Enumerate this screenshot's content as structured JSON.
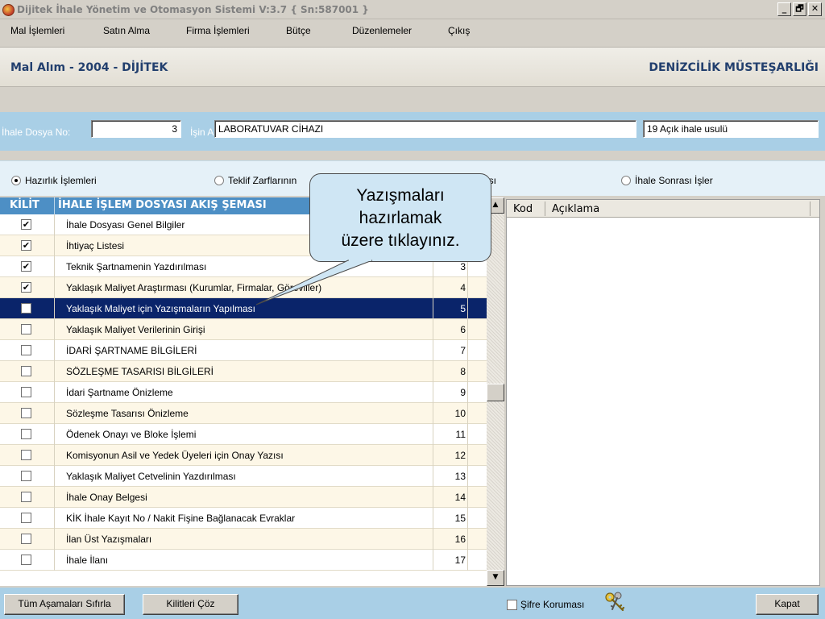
{
  "window": {
    "title": "Dijitek İhale Yönetim ve Otomasyon Sistemi V:3.7 { Sn:587001 }",
    "minimize": "_",
    "maximize": "🗗",
    "close": "✕"
  },
  "menu": [
    "Mal İşlemleri",
    "Satın Alma",
    "Firma İşlemleri",
    "Bütçe",
    "Düzenlemeler",
    "Çıkış"
  ],
  "header": {
    "left": "Mal Alım - 2004 - DİJİTEK",
    "right": "DENİZCİLİK MÜSTEŞARLIĞI"
  },
  "file": {
    "dosya_label": "İhale Dosya No:",
    "dosya_value": "3",
    "isin_label": "İşin Adı:",
    "isin_value": "LABORATUVAR CİHAZI",
    "usul_value": "19   Açık ihale usulü"
  },
  "radios": [
    {
      "label": "Hazırlık İşlemleri",
      "checked": true
    },
    {
      "label": "Teklif Zarflarının",
      "checked": false
    },
    {
      "label": "ması",
      "checked": false
    },
    {
      "label": "İhale Sonrası İşler",
      "checked": false
    }
  ],
  "grid": {
    "col_kilit": "KİLİT",
    "col_title": "İHALE İŞLEM DOSYASI AKIŞ ŞEMASI",
    "rows": [
      {
        "checked": true,
        "title": "İhale Dosyası Genel Bilgiler",
        "no": "1"
      },
      {
        "checked": true,
        "title": "İhtiyaç Listesi",
        "no": "2"
      },
      {
        "checked": true,
        "title": "Teknik Şartnamenin Yazdırılması",
        "no": "3"
      },
      {
        "checked": true,
        "title": "Yaklaşık Maliyet Araştırması (Kurumlar, Firmalar, Görevliler)",
        "no": "4"
      },
      {
        "checked": false,
        "title": "Yaklaşık Maliyet için Yazışmaların Yapılması",
        "no": "5",
        "selected": true
      },
      {
        "checked": false,
        "title": "Yaklaşık Maliyet Verilerinin Girişi",
        "no": "6"
      },
      {
        "checked": false,
        "title": "İDARİ ŞARTNAME BİLGİLERİ",
        "no": "7"
      },
      {
        "checked": false,
        "title": "SÖZLEŞME TASARISI BİLGİLERİ",
        "no": "8"
      },
      {
        "checked": false,
        "title": "İdari Şartname Önizleme",
        "no": "9"
      },
      {
        "checked": false,
        "title": "Sözleşme Tasarısı Önizleme",
        "no": "10"
      },
      {
        "checked": false,
        "title": "Ödenek Onayı ve Bloke İşlemi",
        "no": "11"
      },
      {
        "checked": false,
        "title": "Komisyonun Asil ve Yedek Üyeleri için Onay Yazısı",
        "no": "12"
      },
      {
        "checked": false,
        "title": "Yaklaşık Maliyet Cetvelinin Yazdırılması",
        "no": "13"
      },
      {
        "checked": false,
        "title": "İhale Onay Belgesi",
        "no": "14"
      },
      {
        "checked": false,
        "title": "KİK İhale Kayıt No / Nakit Fişine Bağlanacak Evraklar",
        "no": "15"
      },
      {
        "checked": false,
        "title": "İlan Üst Yazışmaları",
        "no": "16"
      },
      {
        "checked": false,
        "title": "İhale İlanı",
        "no": "17"
      }
    ]
  },
  "right_panel": {
    "col_kod": "Kod",
    "col_aciklama": "Açıklama"
  },
  "callout": {
    "line1": "Yazışmaları",
    "line2": "hazırlamak",
    "line3": "üzere tıklayınız."
  },
  "bottom": {
    "reset_button": "Tüm Aşamaları Sıfırla",
    "unlock_button": "Kilitleri Çöz",
    "password_label": "Şifre Koruması",
    "close_button": "Kapat"
  },
  "colors": {
    "grid_header": "#4d8fc5",
    "selected_row": "#0a246a",
    "band": "#a9cfe6",
    "header_text": "#223f6e"
  }
}
